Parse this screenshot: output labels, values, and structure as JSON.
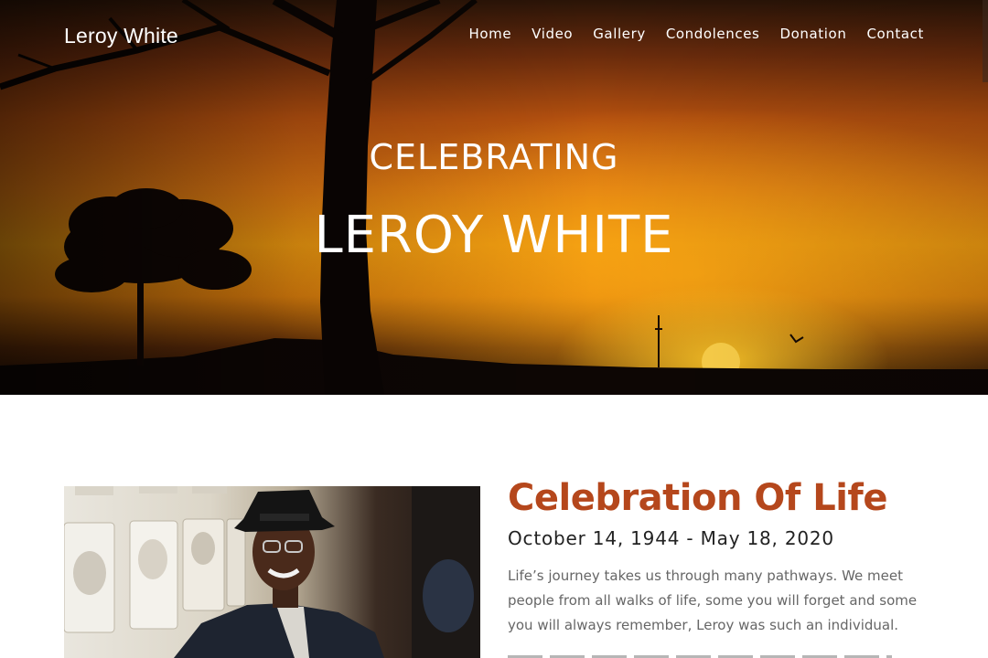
{
  "site": {
    "logo": "Leroy White"
  },
  "nav": {
    "items": [
      "Home",
      "Video",
      "Gallery",
      "Condolences",
      "Donation",
      "Contact"
    ]
  },
  "hero": {
    "subtitle": "CELEBRATING",
    "title": "LEROY WHITE"
  },
  "section": {
    "title": "Celebration Of Life",
    "dates": "October 14, 1944 - May 18, 2020",
    "paragraph": "Life’s journey takes us through many pathways. We meet people from all walks of life, some you will forget and some you will always remember, Leroy was such an individual."
  },
  "colors": {
    "accent": "#b5471c",
    "text_dark": "#222222",
    "text_body": "#666666"
  }
}
